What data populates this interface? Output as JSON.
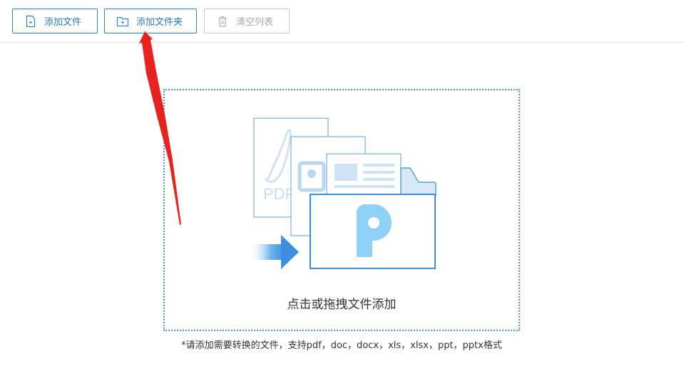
{
  "toolbar": {
    "add_file": {
      "label": "添加文件",
      "icon": "file-add-icon"
    },
    "add_folder": {
      "label": "添加文件夹",
      "icon": "folder-add-icon"
    },
    "clear_list": {
      "label": "清空列表",
      "icon": "trash-icon"
    }
  },
  "dropzone": {
    "label": "点击或拖拽文件添加",
    "pdf_text": "PDF"
  },
  "hint": "*请添加需要转换的文件，支持pdf，doc，docx，xls，xlsx，ppt，pptx格式",
  "colors": {
    "accent": "#2e86c1",
    "dotted_border": "#4a9bd6",
    "annotation_arrow": "#e8231f",
    "disabled": "#a8a8a8"
  }
}
